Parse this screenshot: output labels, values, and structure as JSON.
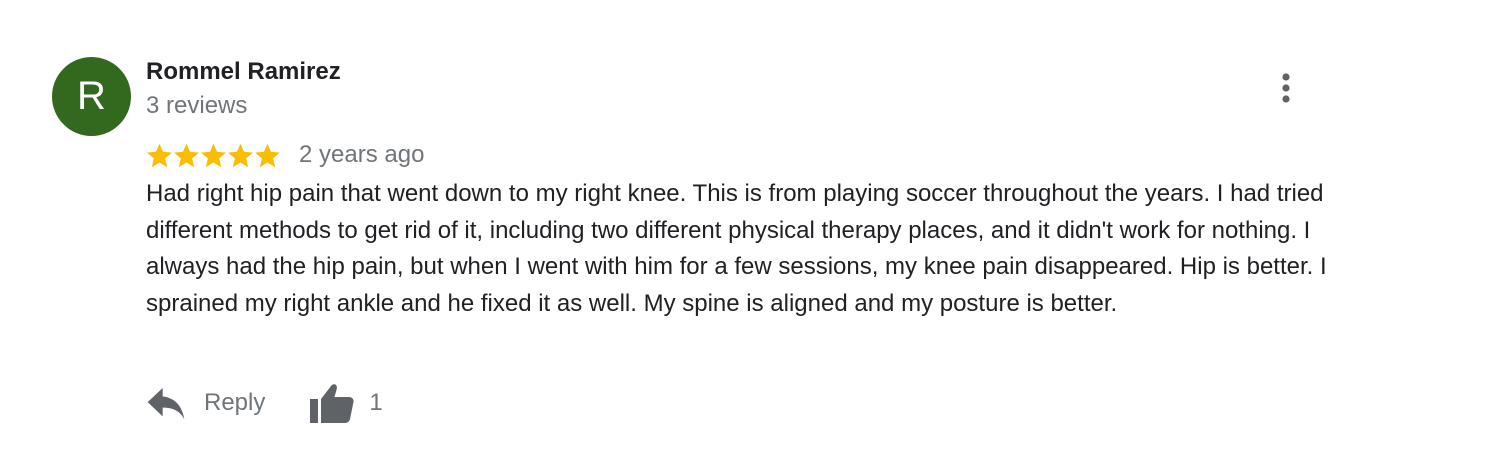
{
  "review": {
    "avatar_letter": "R",
    "avatar_color": "#33691e",
    "author_name": "Rommel Ramirez",
    "review_count": "3 reviews",
    "rating": 5,
    "rating_max": 5,
    "star_color": "#fbbc04",
    "date": "2 years ago",
    "text": "Had right hip pain that went down to my right knee. This is from playing soccer throughout the years. I had tried different methods to get rid of it, including two different physical therapy places, and it didn't work for nothing. I always had the hip pain, but when I went with him for a few sessions, my knee pain disappeared. Hip is better. I sprained my right ankle and he fixed it as well. My spine is aligned and my posture is better.",
    "reply_label": "Reply",
    "like_count": "1",
    "icons": {
      "more": "more-vert-icon",
      "reply": "reply-icon",
      "like": "thumbs-up-icon"
    }
  }
}
